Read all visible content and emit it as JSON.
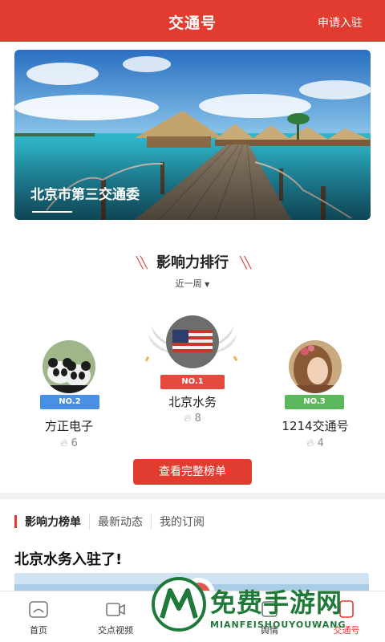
{
  "header": {
    "title": "交通号",
    "apply_label": "申请入驻"
  },
  "banner": {
    "caption": "北京市第三交通委"
  },
  "ranking": {
    "title": "影响力排行",
    "period": "近一周",
    "items": [
      {
        "badge": "NO.2",
        "name": "方正电子",
        "score": "6",
        "badge_color": "#4a90e2"
      },
      {
        "badge": "NO.1",
        "name": "北京水务",
        "score": "8",
        "badge_color": "#e64a3f"
      },
      {
        "badge": "NO.3",
        "name": "1214交通号",
        "score": "4",
        "badge_color": "#5cb85c"
      }
    ],
    "full_list_label": "查看完整榜单"
  },
  "feed_tabs": [
    "影响力榜单",
    "最新动态",
    "我的订阅"
  ],
  "article": {
    "title": "北京水务入驻了!"
  },
  "bottom_nav": [
    {
      "label": "首页",
      "icon": "home-icon"
    },
    {
      "label": "交点视频",
      "icon": "video-icon"
    },
    {
      "label": "",
      "icon": "center-icon"
    },
    {
      "label": "舆情",
      "icon": "opinion-icon"
    },
    {
      "label": "交通号",
      "icon": "traffic-icon"
    }
  ],
  "watermark": {
    "text": "免费手游网",
    "sub": "MIANFEISHOUYOUWANG"
  },
  "colors": {
    "brand": "#e23b30",
    "watermark": "#1f7a3a"
  }
}
